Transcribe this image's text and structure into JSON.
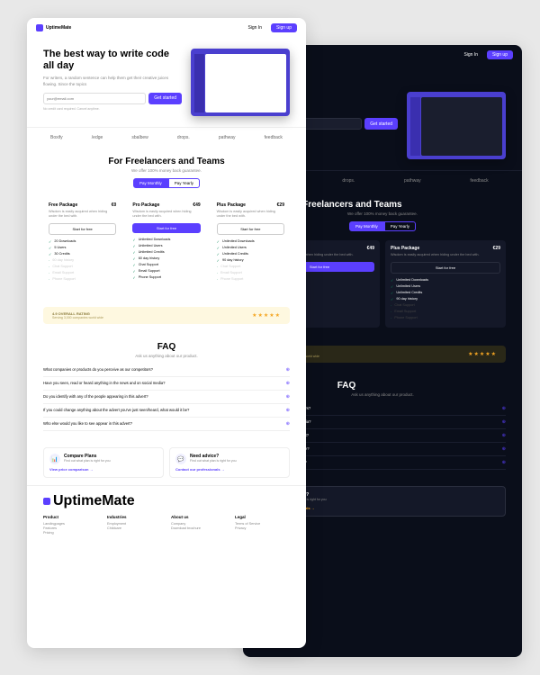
{
  "brand": "UptimeMate",
  "nav": {
    "signin": "Sign In",
    "signup": "Sign up"
  },
  "hero": {
    "title": "The best way to write code all day",
    "subtitle": "For writers, a random sentence can help them get their creative juices flowing. Since the topics",
    "placeholder": "your@email.com",
    "cta": "Get started",
    "note": "No credit card required. Cancel anytime."
  },
  "brands": [
    "Boxify",
    "/edge",
    "sbalbew",
    "drops.",
    "pathway",
    "feedback"
  ],
  "pricing": {
    "title": "For Freelancers and Teams",
    "subtitle": "We offer 100% money back guarantee.",
    "toggle": {
      "monthly": "Pay Monthly",
      "yearly": "Pay Yearly"
    },
    "plans": [
      {
        "name": "Free Package",
        "price": "€0",
        "desc": "Wisdom is easily acquired when hiding under the bed with.",
        "btn": "Start for free",
        "primary": false,
        "features": [
          {
            "t": "20 Downloads",
            "on": true
          },
          {
            "t": "5 Users",
            "on": true
          },
          {
            "t": "30 Credits",
            "on": true
          },
          {
            "t": "60 day history",
            "on": false
          },
          {
            "t": "Chat Support",
            "on": false
          },
          {
            "t": "Email Support",
            "on": false
          },
          {
            "t": "Phone Support",
            "on": false
          }
        ]
      },
      {
        "name": "Pro Package",
        "price": "€49",
        "desc": "Wisdom is easily acquired when hiding under the bed with.",
        "btn": "Start for free",
        "primary": true,
        "features": [
          {
            "t": "Unlimited Downloads",
            "on": true
          },
          {
            "t": "Unlimited Users",
            "on": true
          },
          {
            "t": "Unlimited Credits",
            "on": true
          },
          {
            "t": "60 day history",
            "on": true
          },
          {
            "t": "Chat Support",
            "on": true
          },
          {
            "t": "Email Support",
            "on": true
          },
          {
            "t": "Phone Support",
            "on": true
          }
        ]
      },
      {
        "name": "Plus Package",
        "price": "€29",
        "desc": "Wisdom is easily acquired when hiding under the bed with.",
        "btn": "Start for free",
        "primary": false,
        "features": [
          {
            "t": "Unlimited Downloads",
            "on": true
          },
          {
            "t": "Unlimited Users",
            "on": true
          },
          {
            "t": "Unlimited Credits",
            "on": true
          },
          {
            "t": "90 day history",
            "on": true
          },
          {
            "t": "Chat Support",
            "on": false
          },
          {
            "t": "Email Support",
            "on": false
          },
          {
            "t": "Phone Support",
            "on": false
          }
        ]
      }
    ]
  },
  "rating": {
    "title": "4.9 OVERALL RATING",
    "sub": "Serving 3,000 companies world wide"
  },
  "faq": {
    "title": "FAQ",
    "subtitle": "Ask us anything about our product.",
    "items": [
      "What companies or products do you perceive as our competitors?",
      "Have you seen, read or heard anything in the news and on social media?",
      "Do you identify with any of the people appearing in this advert?",
      "If you could change anything about the advert you've just seen/heard, what would it be?",
      "Who else would you like to see appear in this advert?"
    ]
  },
  "help": [
    {
      "icon": "📊",
      "title": "Compare Plans",
      "sub": "Find out what plan is right for you",
      "link": "View price comparison →"
    },
    {
      "icon": "💬",
      "title": "Need advice?",
      "sub": "Find out what plan is right for you",
      "link": "Contact our professionals →"
    }
  ],
  "footer": {
    "cols": [
      {
        "h": "Product",
        "items": [
          "Landingpages",
          "Features",
          "Pricing"
        ]
      },
      {
        "h": "Industries",
        "items": [
          "Employment",
          "Childcare"
        ]
      },
      {
        "h": "About us",
        "items": [
          "Company",
          "Download brochure"
        ]
      },
      {
        "h": "Legal",
        "items": [
          "Terms of Service",
          "Privacy"
        ]
      }
    ]
  }
}
